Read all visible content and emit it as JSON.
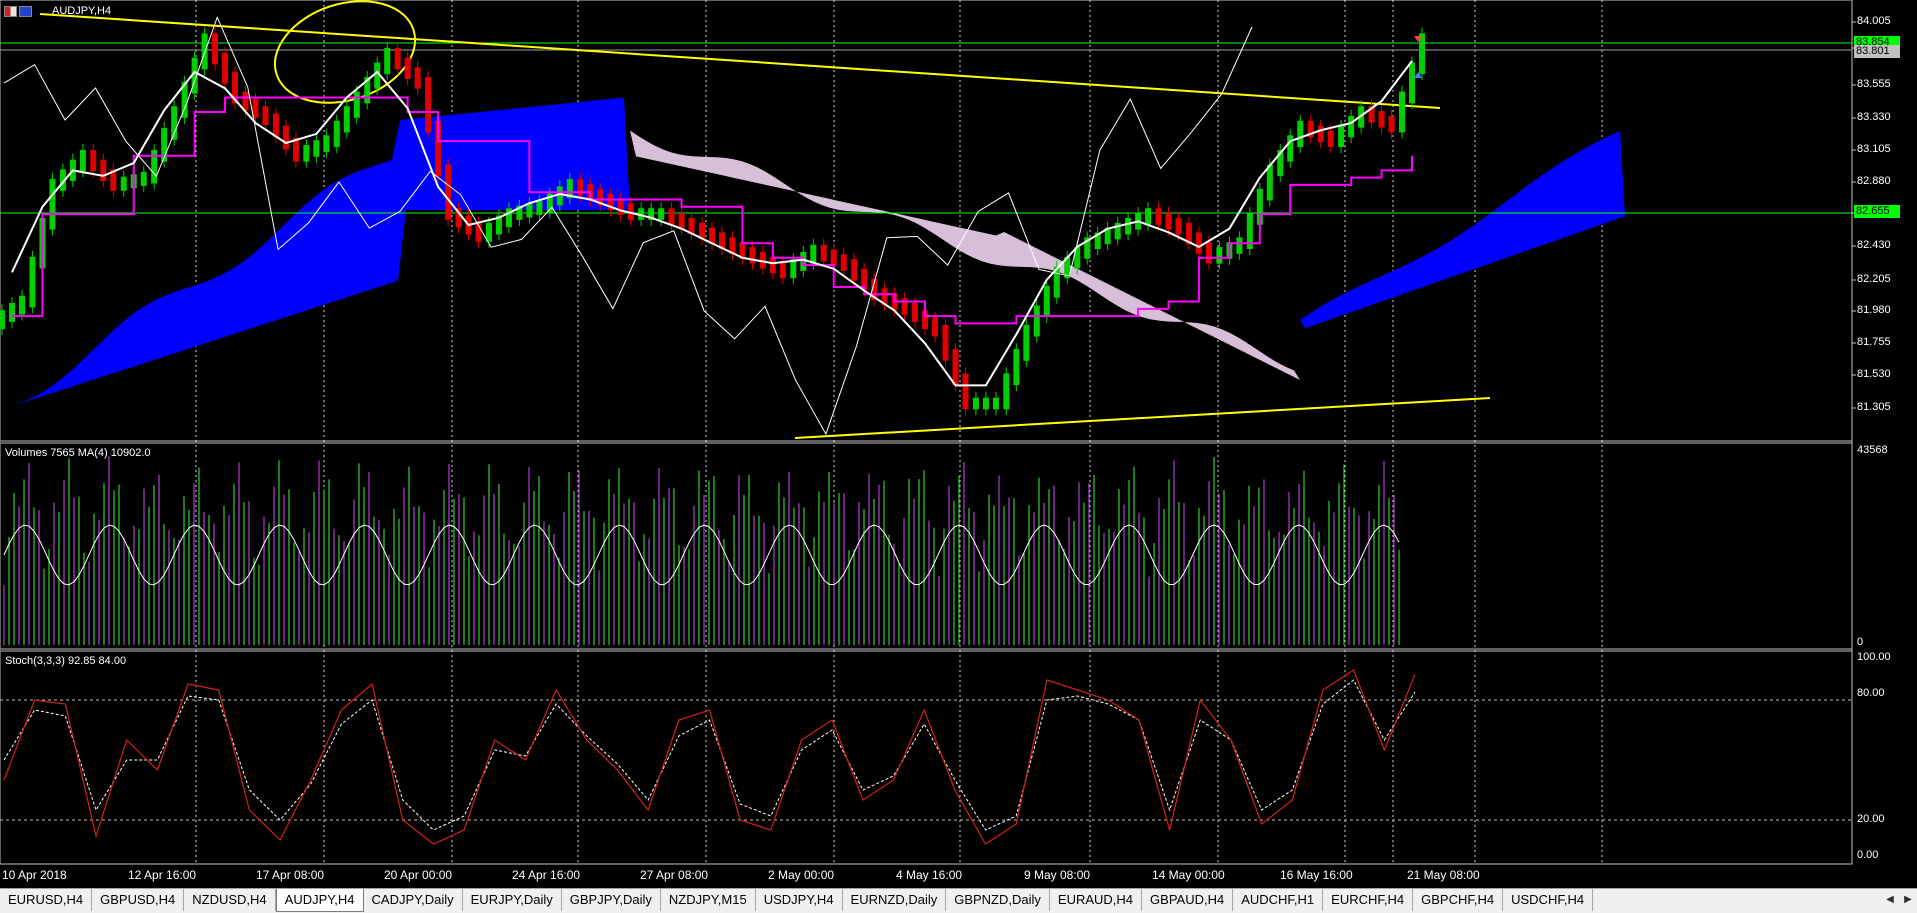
{
  "window": {
    "title": "AUDJPY,H4"
  },
  "chart": {
    "indicator_volume_label": "Volumes 7565 MA(4) 10902.0",
    "indicator_stoch_label": "Stoch(3,3,3) 92.85 84.00",
    "current_price_ask": "83.854",
    "current_price_bid": "83.801",
    "level_line_price": "82.655",
    "colors": {
      "background": "#000000",
      "bull_candle": "#00d000",
      "bear_candle": "#e00000",
      "cloud_a": "#0000ff",
      "cloud_b": "#d8bfd8",
      "trendline": "#ffff00",
      "hline": "#00ff00",
      "kijun": "#ff00ff",
      "tenkan": "#ffffff",
      "stoch_main": "#d02020",
      "stoch_signal": "#ffffff"
    }
  },
  "chart_data": [
    {
      "type": "line",
      "title": "AUDJPY,H4",
      "xlabel": "",
      "ylabel": "",
      "ylim": [
        81.15,
        84.1
      ],
      "y_ticks": [
        "84.005",
        "83.780",
        "83.555",
        "83.330",
        "83.105",
        "82.880",
        "82.655",
        "82.430",
        "82.205",
        "81.980",
        "81.755",
        "81.530",
        "81.305"
      ],
      "x_ticks": [
        "10 Apr 2018",
        "12 Apr 16:00",
        "17 Apr 08:00",
        "20 Apr 00:00",
        "24 Apr 16:00",
        "27 Apr 08:00",
        "2 May 00:00",
        "4 May 16:00",
        "9 May 08:00",
        "14 May 00:00",
        "16 May 16:00",
        "21 May 08:00"
      ],
      "series": [
        {
          "name": "Close",
          "values": [
            82.1,
            82.9,
            83.1,
            82.9,
            82.95,
            83.4,
            83.9,
            83.5,
            83.35,
            83.1,
            83.2,
            83.5,
            83.8,
            83.6,
            82.7,
            82.55,
            82.7,
            82.75,
            82.9,
            82.8,
            82.7,
            82.7,
            82.6,
            82.5,
            82.4,
            82.3,
            82.45,
            82.35,
            82.15,
            82.05,
            81.9,
            81.4,
            81.4,
            81.9,
            82.3,
            82.5,
            82.6,
            82.7,
            82.6,
            82.4,
            82.5,
            83.0,
            83.3,
            83.2,
            83.4,
            83.3,
            83.9
          ]
        },
        {
          "name": "Kijun",
          "values": [
            82.0,
            82.7,
            82.7,
            82.7,
            83.1,
            83.1,
            83.4,
            83.5,
            83.5,
            83.5,
            83.5,
            83.5,
            83.5,
            83.4,
            83.2,
            83.2,
            83.2,
            82.85,
            82.85,
            82.8,
            82.8,
            82.8,
            82.75,
            82.75,
            82.5,
            82.4,
            82.35,
            82.2,
            82.15,
            82.1,
            82.0,
            81.95,
            81.95,
            82.0,
            82.0,
            82.0,
            82.0,
            82.05,
            82.1,
            82.4,
            82.5,
            82.7,
            82.9,
            82.9,
            82.95,
            83.0,
            83.1
          ]
        }
      ]
    },
    {
      "type": "bar",
      "title": "Volumes 7565 MA(4) 10902.0",
      "ylim": [
        0,
        43568
      ],
      "y_ticks": [
        "43568",
        "0"
      ],
      "series": [
        {
          "name": "Volumes",
          "values": [
            7565
          ]
        },
        {
          "name": "MA(4)",
          "values": [
            10902.0
          ]
        }
      ]
    },
    {
      "type": "line",
      "title": "Stoch(3,3,3) 92.85 84.00",
      "ylim": [
        0,
        100
      ],
      "y_ticks": [
        "100.00",
        "80.00",
        "20.00",
        "0.00"
      ],
      "series": [
        {
          "name": "Main",
          "values": [
            40,
            80,
            78,
            12,
            60,
            45,
            88,
            85,
            25,
            10,
            40,
            75,
            88,
            20,
            8,
            15,
            60,
            50,
            85,
            60,
            45,
            25,
            70,
            75,
            20,
            15,
            60,
            70,
            30,
            40,
            75,
            35,
            8,
            18,
            90,
            85,
            80,
            70,
            15,
            80,
            60,
            18,
            30,
            85,
            95,
            55,
            92.85
          ]
        },
        {
          "name": "Signal",
          "values": [
            50,
            75,
            72,
            25,
            50,
            50,
            82,
            80,
            35,
            20,
            38,
            68,
            80,
            30,
            15,
            22,
            55,
            52,
            78,
            62,
            48,
            30,
            62,
            70,
            28,
            22,
            55,
            65,
            35,
            42,
            68,
            40,
            15,
            22,
            80,
            82,
            78,
            70,
            25,
            70,
            60,
            25,
            35,
            78,
            90,
            60,
            84.0
          ]
        }
      ]
    }
  ],
  "tabs": [
    {
      "label": "EURUSD,H4",
      "active": false
    },
    {
      "label": "GBPUSD,H4",
      "active": false
    },
    {
      "label": "NZDUSD,H4",
      "active": false
    },
    {
      "label": "AUDJPY,H4",
      "active": true
    },
    {
      "label": "CADJPY,Daily",
      "active": false
    },
    {
      "label": "EURJPY,Daily",
      "active": false
    },
    {
      "label": "GBPJPY,Daily",
      "active": false
    },
    {
      "label": "NZDJPY,M15",
      "active": false
    },
    {
      "label": "USDJPY,H4",
      "active": false
    },
    {
      "label": "EURNZD,Daily",
      "active": false
    },
    {
      "label": "GBPNZD,Daily",
      "active": false
    },
    {
      "label": "EURAUD,H4",
      "active": false
    },
    {
      "label": "GBPAUD,H4",
      "active": false
    },
    {
      "label": "AUDCHF,H1",
      "active": false
    },
    {
      "label": "EURCHF,H4",
      "active": false
    },
    {
      "label": "GBPCHF,H4",
      "active": false
    },
    {
      "label": "USDCHF,H4",
      "active": false
    }
  ],
  "tab_scroll": {
    "left_icon": "triangle-left-icon",
    "right_icon": "triangle-right-icon"
  }
}
